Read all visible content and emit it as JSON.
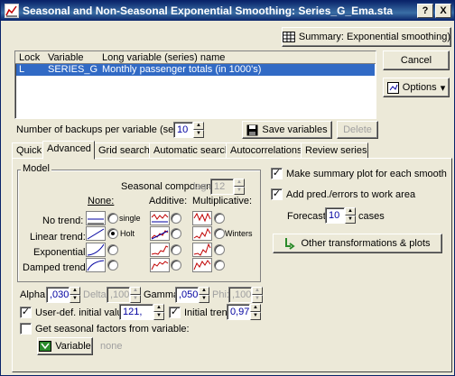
{
  "window": {
    "title": "Seasonal and Non-Seasonal Exponential Smoothing: Series_G_Ema.sta"
  },
  "title_buttons": {
    "help": "?",
    "close": "X"
  },
  "right_buttons": {
    "summary": "Summary:  Exponential smoothing)",
    "cancel": "Cancel",
    "options": "Options"
  },
  "list": {
    "headers": [
      "Lock",
      "Variable",
      "Long variable (series) name"
    ],
    "rows": [
      {
        "lock": "L",
        "variable": "SERIES_G",
        "long_name": "Monthly passenger totals (in 1000's)"
      }
    ]
  },
  "backups": {
    "label": "Number of backups per variable (series):",
    "value": "10"
  },
  "save_variables": "Save variables",
  "delete": "Delete",
  "tabs": [
    "Quick",
    "Advanced",
    "Grid search",
    "Automatic search",
    "Autocorrelations",
    "Review series"
  ],
  "active_tab": "Advanced",
  "model": {
    "group_label": "Model",
    "seasonal_component_label": "Seasonal component:",
    "lag_label": "lag=",
    "lag_value": "12",
    "col_none": "None:",
    "col_additive": "Additive:",
    "col_multiplicative": "Multiplicative:",
    "rows": [
      {
        "label": "No trend:",
        "none_text": "single",
        "mult_text": ""
      },
      {
        "label": "Linear trend:",
        "none_text": "Holt",
        "mult_text": "Winters"
      },
      {
        "label": "Exponential:",
        "none_text": "",
        "mult_text": ""
      },
      {
        "label": "Damped trend:",
        "none_text": "",
        "mult_text": ""
      }
    ],
    "selected": "Linear trend / None (Holt)"
  },
  "params": {
    "alpha_label": "Alpha:",
    "alpha_value": ",030",
    "delta_label": "Delta:",
    "delta_value": ",100",
    "gamma_label": "Gamma:",
    "gamma_value": ",050",
    "phi_label": "Phi:",
    "phi_value": ",100"
  },
  "initial": {
    "user_def_label": "User-def. initial value:",
    "user_def_value": "121,",
    "initial_trend_label": "Initial trend:",
    "initial_trend_value": "0,97",
    "get_seasonal_label": "Get seasonal factors from variable:",
    "variable_button": "Variable",
    "variable_value": "none"
  },
  "right_panel": {
    "summary_plot_label": "Make summary plot for each smooth",
    "add_pred_label": "Add pred./errors to work area",
    "forecast_label": "Forecast",
    "forecast_value": "10",
    "cases_label": "cases",
    "other_transformations": "Other transformations & plots"
  }
}
